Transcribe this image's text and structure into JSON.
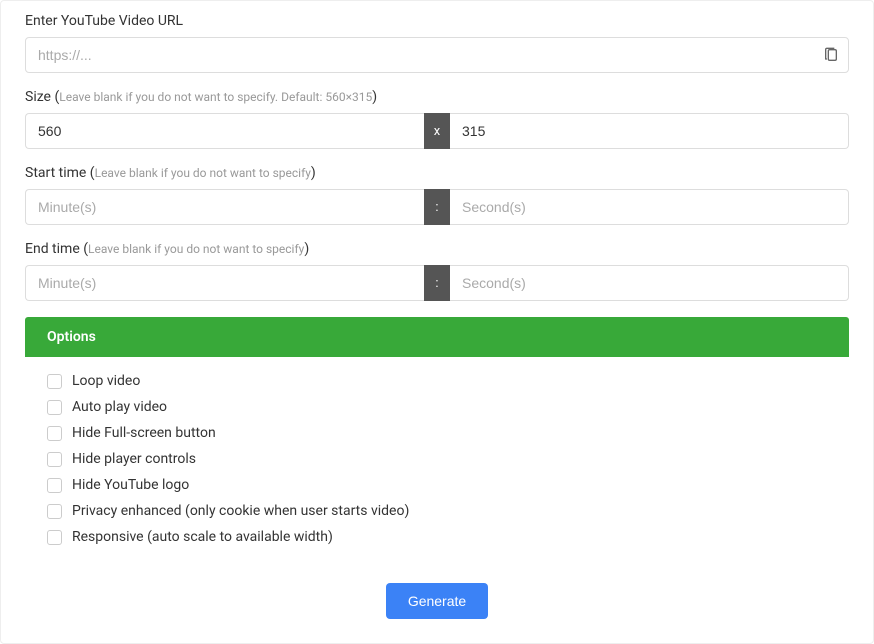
{
  "url_field": {
    "label": "Enter YouTube Video URL",
    "placeholder": "https://..."
  },
  "size_field": {
    "label_prefix": "Size (",
    "hint": "Leave blank if you do not want to specify. Default: 560×315",
    "label_suffix": ")",
    "width_value": "560",
    "height_value": "315",
    "separator": "x"
  },
  "start_time": {
    "label_prefix": "Start time (",
    "hint": "Leave blank if you do not want to specify",
    "label_suffix": ")",
    "minutes_placeholder": "Minute(s)",
    "seconds_placeholder": "Second(s)",
    "separator": ":"
  },
  "end_time": {
    "label_prefix": "End time (",
    "hint": "Leave blank if you do not want to specify",
    "label_suffix": ")",
    "minutes_placeholder": "Minute(s)",
    "seconds_placeholder": "Second(s)",
    "separator": ":"
  },
  "options": {
    "header": "Options",
    "items": [
      "Loop video",
      "Auto play video",
      "Hide Full-screen button",
      "Hide player controls",
      "Hide YouTube logo",
      "Privacy enhanced (only cookie when user starts video)",
      "Responsive (auto scale to available width)"
    ]
  },
  "generate_button": "Generate"
}
